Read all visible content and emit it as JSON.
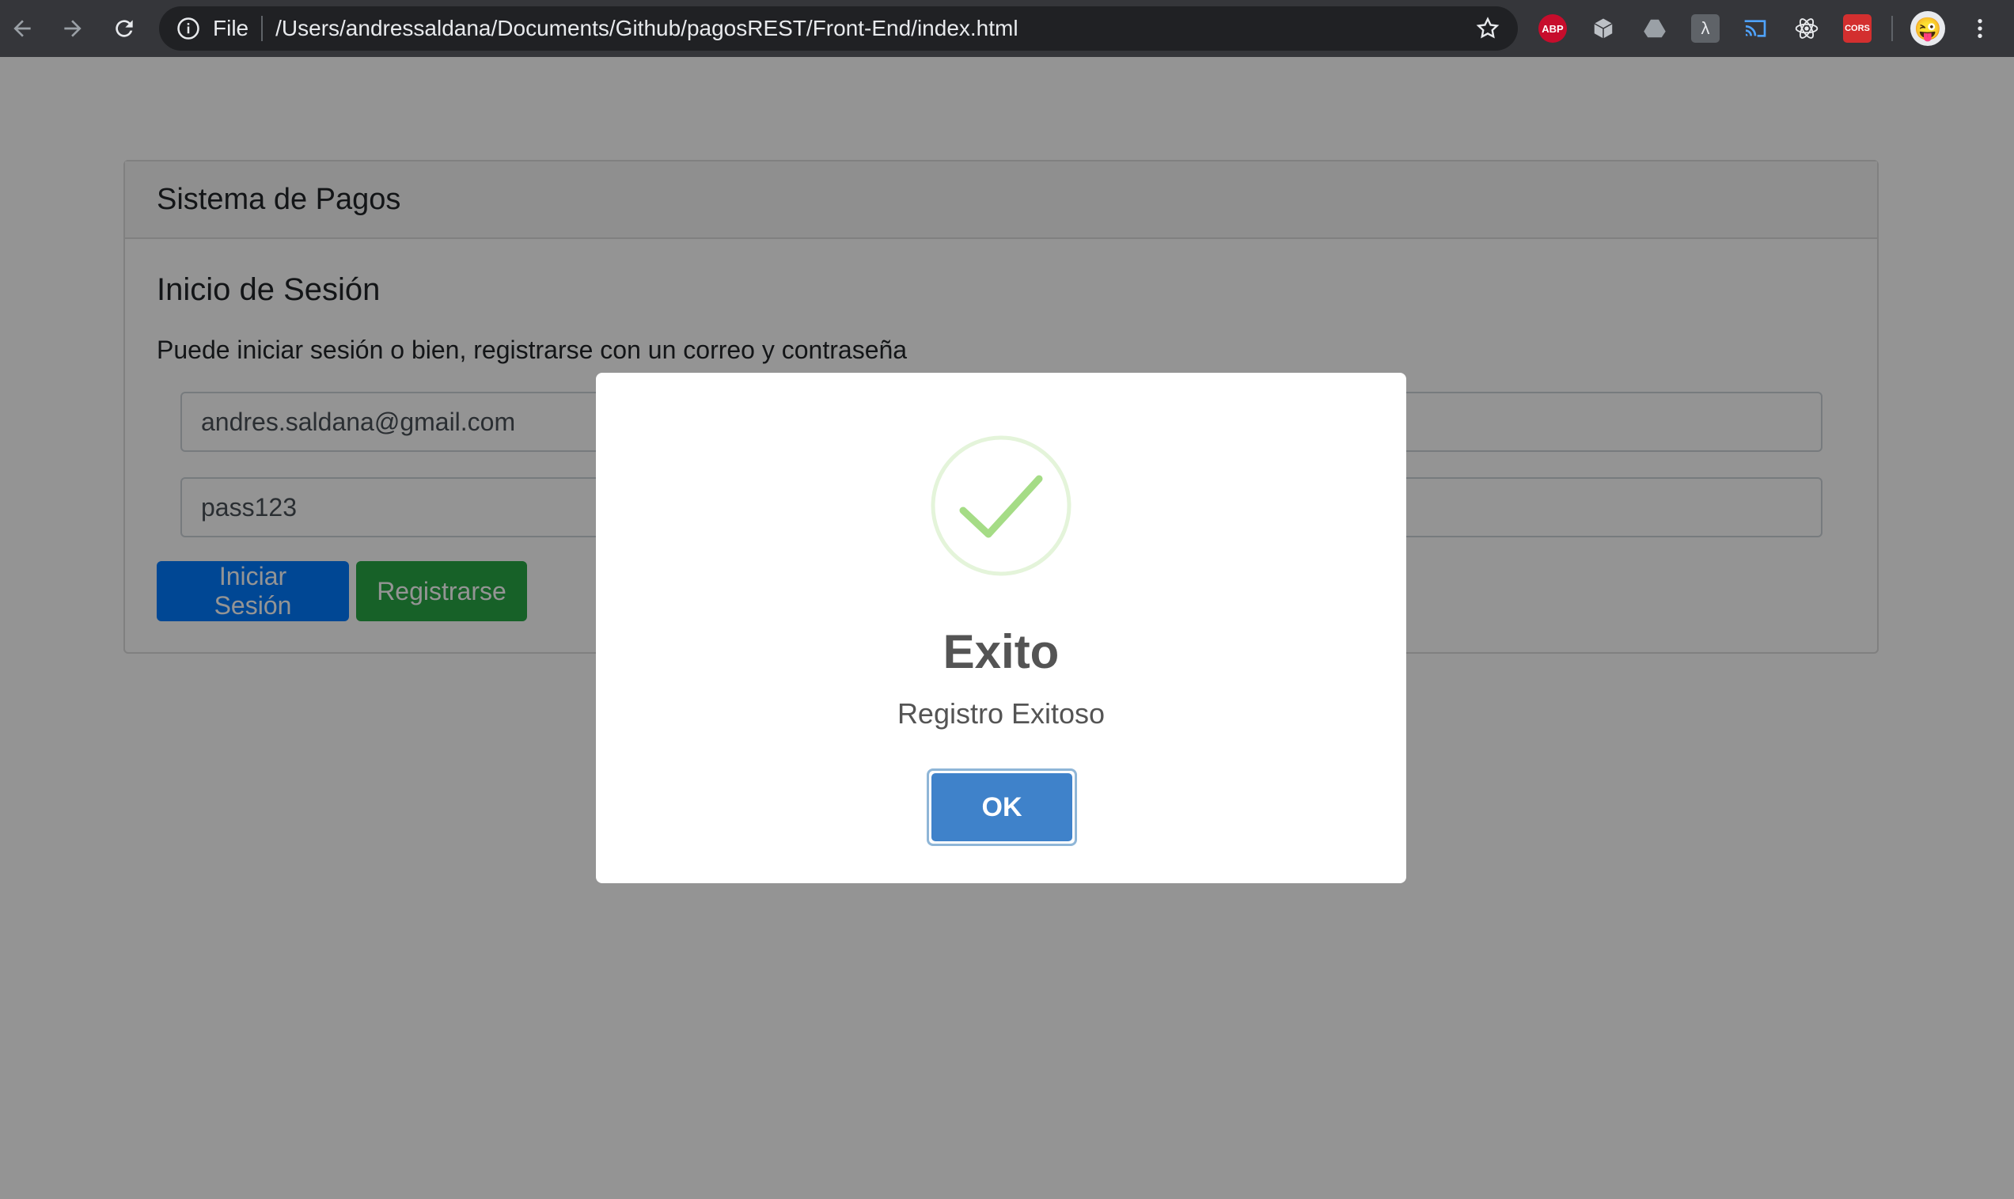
{
  "browser": {
    "url_scheme": "File",
    "url": "/Users/andressaldana/Documents/Github/pagosREST/Front-End/index.html",
    "extensions": [
      {
        "name": "adblock-plus-icon",
        "label": "ABP"
      },
      {
        "name": "cube-icon",
        "label": ""
      },
      {
        "name": "drive-icon",
        "label": ""
      },
      {
        "name": "lambda-icon",
        "label": "λ"
      },
      {
        "name": "cast-icon",
        "label": ""
      },
      {
        "name": "react-icon",
        "label": ""
      },
      {
        "name": "cors-icon",
        "label": "CORS"
      }
    ],
    "avatar_emoji": "😜"
  },
  "card": {
    "header": "Sistema de Pagos",
    "title": "Inicio de Sesión",
    "text": "Puede iniciar sesión o bien, registrarse con un correo y contraseña",
    "email_value": "andres.saldana@gmail.com",
    "password_value": "pass123",
    "login_label": "Iniciar Sesión",
    "register_label": "Registrarse"
  },
  "modal": {
    "title": "Exito",
    "text": "Registro Exitoso",
    "ok_label": "OK"
  },
  "colors": {
    "primary": "#007bff",
    "success": "#28a745",
    "modal_button": "#3f82ca",
    "check": "#a5dc86"
  }
}
